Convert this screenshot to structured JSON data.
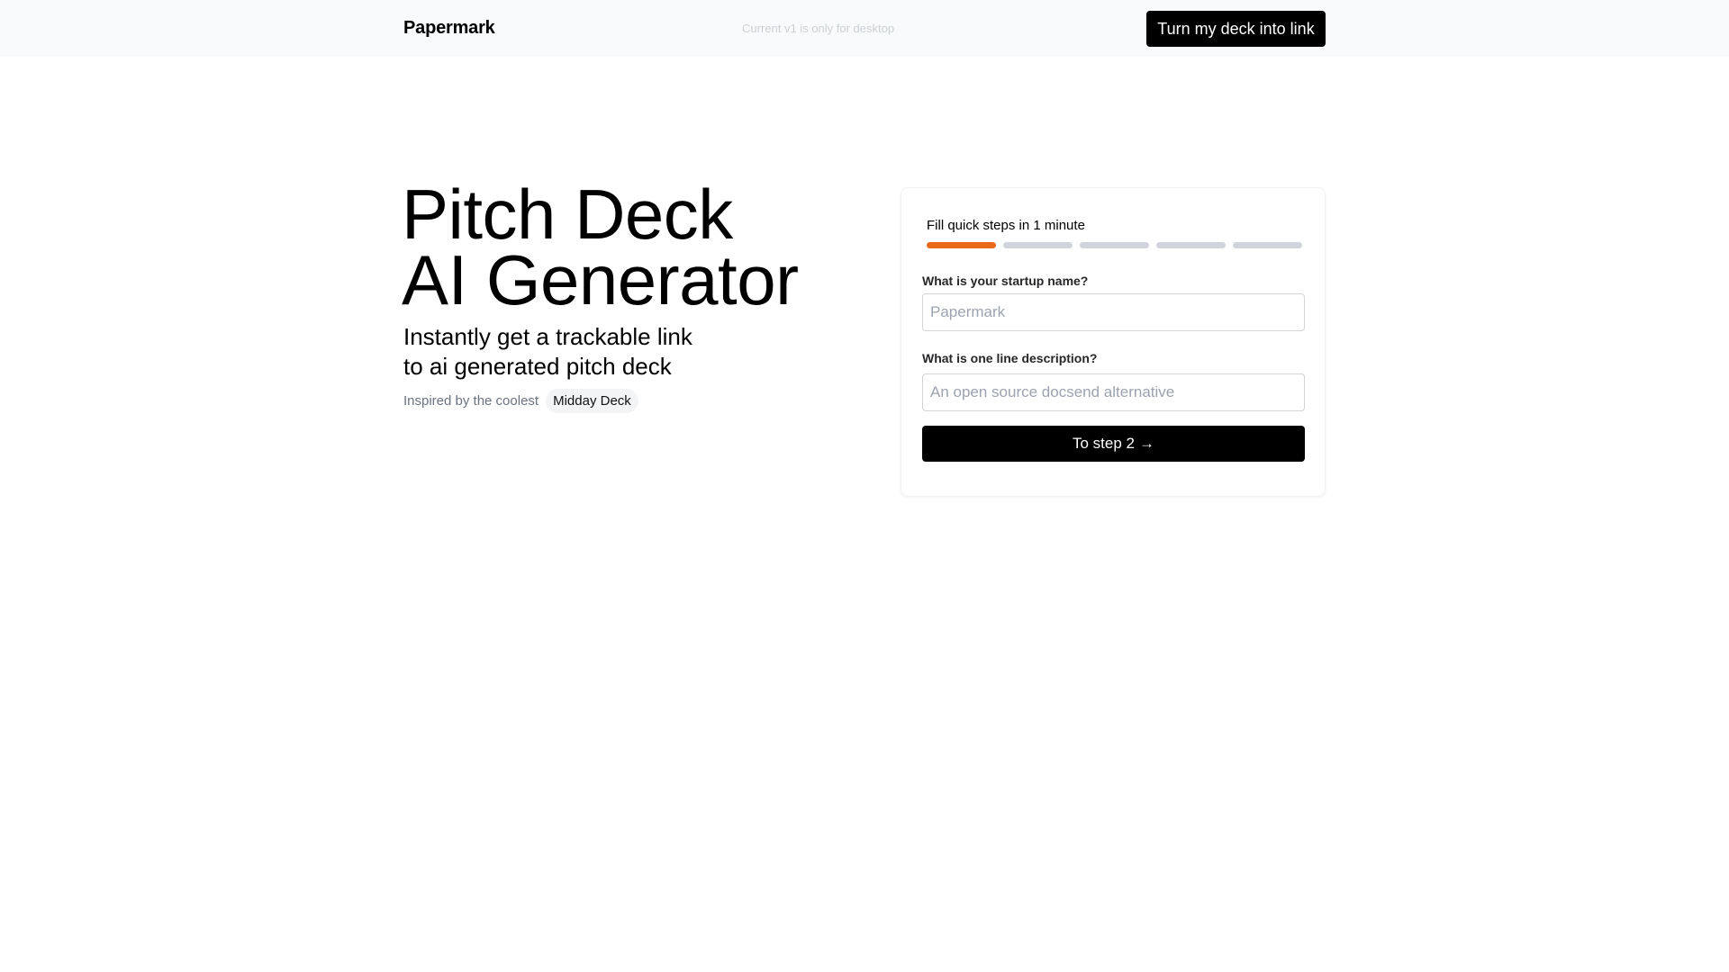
{
  "header": {
    "brand": "Papermark",
    "notice": "Current v1 is only for desktop",
    "cta_label": "Turn my deck into link"
  },
  "hero": {
    "title_line1": "Pitch Deck",
    "title_line2": "AI Generator",
    "subtitle_line1": "Instantly get a trackable link",
    "subtitle_line2": "to ai generated pitch deck",
    "inspired_label": "Inspired by the coolest",
    "inspired_chip": "Midday Deck"
  },
  "form": {
    "heading": "Fill quick steps in 1 minute",
    "steps": {
      "total": 5,
      "current": 1,
      "active_color": "#ea6a1c",
      "inactive_color": "#d1d5db"
    },
    "fields": [
      {
        "label": "What is your startup name?",
        "placeholder": "Papermark",
        "value": ""
      },
      {
        "label": "What is one line description?",
        "placeholder": "An open source docsend alternative",
        "value": ""
      }
    ],
    "next_label": "To step 2",
    "next_icon": "arrow-right-icon"
  },
  "colors": {
    "accent": "#ea6a1c",
    "primary_button": "#000000",
    "topbar_bg": "#f9fafb"
  }
}
